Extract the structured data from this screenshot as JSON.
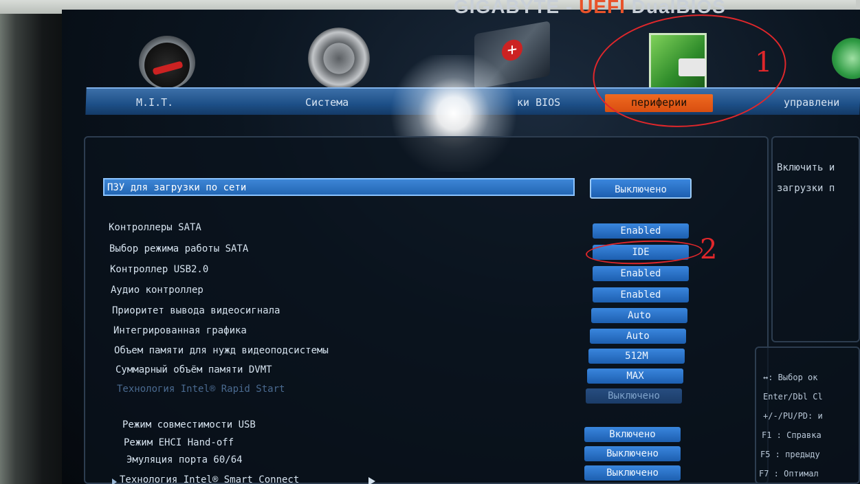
{
  "header": {
    "brand_left": "GIGABYTE - ",
    "brand_uefi": "UEFI",
    "brand_right": " DualBIOS"
  },
  "tabs": [
    {
      "label": "M.I.T.",
      "icon": "gauge-icon"
    },
    {
      "label": "Система",
      "icon": "gear-icon"
    },
    {
      "label": "ки BIOS",
      "icon": "chip-icon"
    },
    {
      "label": "периферии",
      "icon": "peripheral-icon",
      "active": true
    },
    {
      "label": "управлени",
      "icon": "green-circle-icon"
    }
  ],
  "settings": {
    "network_boot": {
      "label": "ПЗУ для загрузки по сети",
      "value": "Выключено"
    },
    "rows": [
      {
        "label": "Контроллеры SATA",
        "value": "Enabled"
      },
      {
        "label": "Выбор режима работы SATA",
        "value": "IDE"
      },
      {
        "label": "Контроллер USB2.0",
        "value": "Enabled"
      },
      {
        "label": "Аудио контроллер",
        "value": "Enabled"
      },
      {
        "label": "Приоритет вывода видеосигнала",
        "value": "Auto"
      },
      {
        "label": "Интегрированная графика",
        "value": "Auto"
      },
      {
        "label": "Объем памяти для нужд видеоподсистемы",
        "value": "512M"
      },
      {
        "label": "Суммарный объём памяти DVMT",
        "value": "MAX"
      },
      {
        "label": "Технология Intel® Rapid Start",
        "value": "Выключено"
      }
    ],
    "usb_rows": [
      {
        "label": "Режим совместимости USB",
        "value": "Включено"
      },
      {
        "label": "Режим EHCI Hand-off",
        "value": "Выключено"
      },
      {
        "label": "Эмуляция порта 60/64",
        "value": "Выключено"
      }
    ],
    "submenu": {
      "label": "Технология Intel® Smart Connect"
    }
  },
  "help": {
    "line1": "Включить и",
    "line2": "загрузки п"
  },
  "keys": [
    "↔: Выбор ок",
    "Enter/Dbl Cl",
    "+/-/PU/PD: и",
    "F1  : Справка",
    "F5  : предыду",
    "F7  : Оптимал"
  ],
  "annotations": {
    "mark1": "1",
    "mark2": "2"
  },
  "colors": {
    "accent_orange": "#e06020",
    "highlight_blue": "#2f7ad0",
    "annotation_red": "#e0272b"
  }
}
